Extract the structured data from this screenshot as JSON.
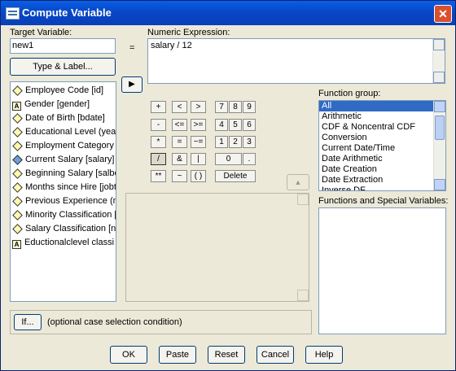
{
  "window": {
    "title": "Compute Variable",
    "close_glyph": "✕"
  },
  "target": {
    "label": "Target Variable:",
    "value": "new1",
    "type_label_button": "Type & Label..."
  },
  "equals": "=",
  "expression": {
    "label": "Numeric Expression:",
    "value": "salary / 12"
  },
  "move_button_glyph": "▶",
  "variables": [
    {
      "name": "Employee Code [id]",
      "icon": "ruler"
    },
    {
      "name": "Gender [gender]",
      "icon": "string-A"
    },
    {
      "name": "Date of Birth [bdate]",
      "icon": "ruler"
    },
    {
      "name": "Educational Level (yea",
      "icon": "ruler"
    },
    {
      "name": "Employment Category [",
      "icon": "ruler"
    },
    {
      "name": "Current Salary [salary]",
      "icon": "ruler-selected"
    },
    {
      "name": "Beginning Salary [salbe",
      "icon": "ruler"
    },
    {
      "name": "Months since Hire [jobt",
      "icon": "ruler"
    },
    {
      "name": "Previous Experience (n",
      "icon": "ruler"
    },
    {
      "name": "Minority Classification [",
      "icon": "ruler"
    },
    {
      "name": "Salary Classification [ne",
      "icon": "ruler"
    },
    {
      "name": "Eductionalclevel classi",
      "icon": "string-A"
    }
  ],
  "string_icon_letter": "A",
  "calculator": {
    "row1": [
      "+",
      "<",
      ">",
      "7",
      "8",
      "9"
    ],
    "row2": [
      "-",
      "<=",
      ">=",
      "4",
      "5",
      "6"
    ],
    "row3": [
      "*",
      "=",
      "~=",
      "1",
      "2",
      "3"
    ],
    "row4": [
      "/",
      "&",
      "|",
      "0",
      "."
    ],
    "row5": [
      "**",
      "~",
      "( )"
    ],
    "delete": "Delete"
  },
  "function_group": {
    "label": "Function group:",
    "items": [
      "All",
      "Arithmetic",
      "CDF & Noncentral CDF",
      "Conversion",
      "Current Date/Time",
      "Date Arithmetic",
      "Date Creation",
      "Date Extraction",
      "Inverse DF"
    ],
    "selected": "All"
  },
  "functions_label": "Functions and Special Variables:",
  "up_button_glyph": "▲",
  "if_button": "If...",
  "if_condition": "(optional case selection condition)",
  "buttons": {
    "ok": "OK",
    "paste": "Paste",
    "reset": "Reset",
    "cancel": "Cancel",
    "help": "Help"
  }
}
